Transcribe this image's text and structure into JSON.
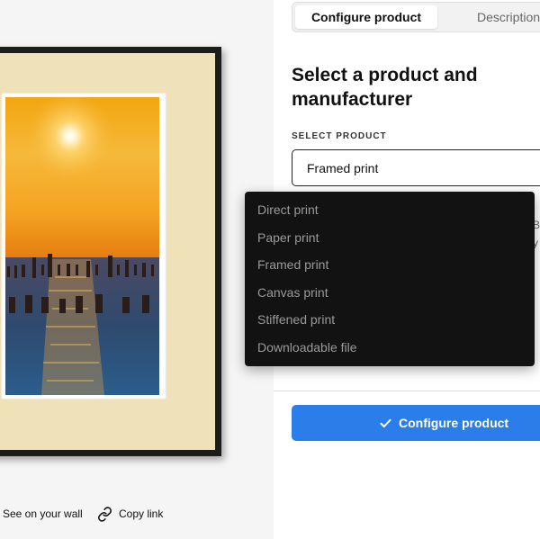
{
  "preview": {
    "actions": {
      "see_on_wall": "See on your wall",
      "copy_link": "Copy link"
    }
  },
  "tabs": {
    "configure": "Configure product",
    "description": "Description"
  },
  "panel": {
    "heading_line1": "Select a product and",
    "heading_line2": "manufacturer",
    "select_label": "SELECT PRODUCT",
    "selected_value": "Framed print",
    "peek_chars": [
      "i",
      "B",
      "y"
    ]
  },
  "dropdown": {
    "options": [
      "Direct print",
      "Paper print",
      "Framed print",
      "Canvas print",
      "Stiffened print",
      "Downloadable file"
    ]
  },
  "cta": {
    "label": "Configure product"
  },
  "colors": {
    "accent": "#2b7de9",
    "frame": "#1c1c1c",
    "mat": "#efe2b9",
    "menu_bg": "#121212"
  }
}
